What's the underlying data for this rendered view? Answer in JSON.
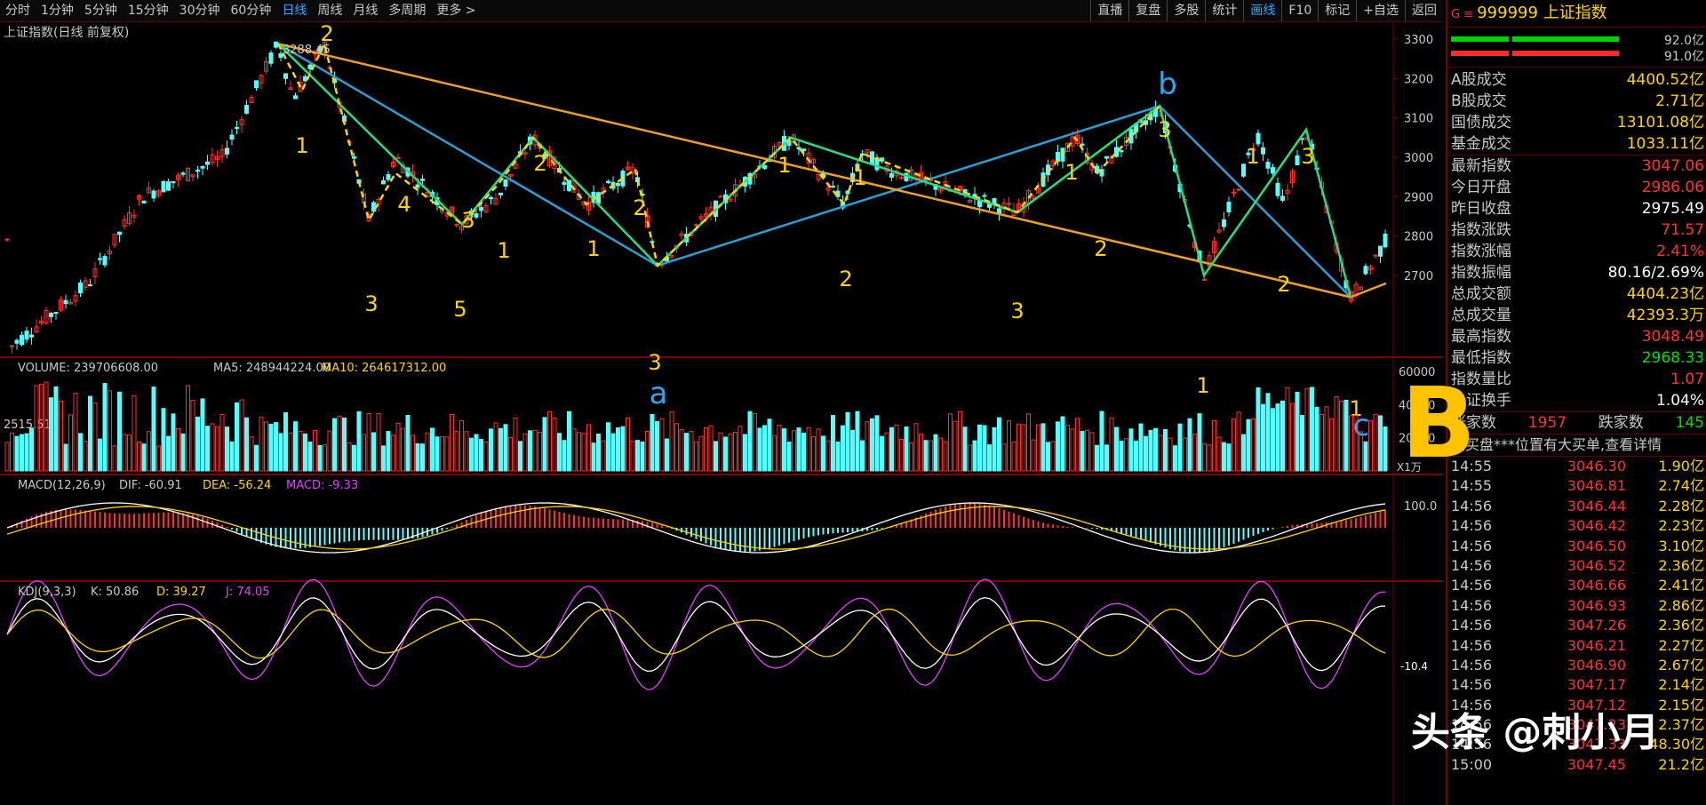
{
  "toolbar": {
    "left": [
      "分时",
      "1分钟",
      "5分钟",
      "15分钟",
      "30分钟",
      "60分钟",
      "日线",
      "周线",
      "月线",
      "多周期",
      "更多 >"
    ],
    "active_index": 6,
    "right": [
      "直播",
      "复盘",
      "多股",
      "统计",
      "画线",
      "F10",
      "标记",
      "+自选",
      "返回"
    ],
    "right_active_index": 4
  },
  "chart": {
    "title": "上证指数(日线 前复权)",
    "high_label": "3288.45",
    "low_label": "2515.51",
    "y_ticks": [
      "3300",
      "3200",
      "3100",
      "3000",
      "2900",
      "2800",
      "2700"
    ],
    "wave_labels_yellow": [
      "2",
      "1",
      "3",
      "4",
      "5",
      "3",
      "1",
      "2",
      "1",
      "2",
      "3",
      "1",
      "2",
      "1",
      "3",
      "1",
      "2",
      "3",
      "1",
      "1",
      "2",
      "3",
      "1"
    ],
    "wave_labels_blue": [
      "a",
      "b",
      "c"
    ]
  },
  "volume": {
    "label": "VOLUME: 239706608.00",
    "ma5": "MA5: 248944224.00",
    "ma10": "MA10: 264617312.00",
    "y_ticks": [
      "60000",
      "40000",
      "20000"
    ],
    "unit": "X1万"
  },
  "macd": {
    "label": "MACD(12,26,9)",
    "dif": "DIF: -60.91",
    "dea": "DEA: -56.24",
    "macd": "MACD: -9.33",
    "y_tick": "100.0"
  },
  "kdj": {
    "label": "KDJ(9,3,3)",
    "k": "K: 50.86",
    "d": "D: 39.27",
    "j": "J: 74.05",
    "axis_value": "-10.4"
  },
  "side": {
    "header_code": "999999",
    "header_name": "上证指数",
    "bar_values": [
      "92.0亿",
      "91.0亿"
    ],
    "turnover": [
      {
        "label": "A股成交",
        "value": "4400.52亿",
        "color": "#ffd400"
      },
      {
        "label": "B股成交",
        "value": "2.71亿",
        "color": "#ffd400"
      },
      {
        "label": "国债成交",
        "value": "13101.08亿",
        "color": "#ffd400"
      },
      {
        "label": "基金成交",
        "value": "1033.11亿",
        "color": "#ffd400"
      }
    ],
    "stats": [
      {
        "label": "最新指数",
        "value": "3047.06",
        "color": "#ff3333"
      },
      {
        "label": "今日开盘",
        "value": "2986.06",
        "color": "#ff3333"
      },
      {
        "label": "昨日收盘",
        "value": "2975.49",
        "color": "#ffffff"
      },
      {
        "label": "指数涨跌",
        "value": "71.57",
        "color": "#ff3333"
      },
      {
        "label": "指数涨幅",
        "value": "2.41%",
        "color": "#ff3333"
      },
      {
        "label": "指数振幅",
        "value": "80.16/2.69%",
        "color": "#ffffff"
      },
      {
        "label": "总成交额",
        "value": "4404.23亿",
        "color": "#ffd400"
      },
      {
        "label": "总成交量",
        "value": "42393.3万",
        "color": "#ffd400"
      },
      {
        "label": "最高指数",
        "value": "3048.49",
        "color": "#ff3333"
      },
      {
        "label": "最低指数",
        "value": "2968.33",
        "color": "#00e000"
      },
      {
        "label": "指数量比",
        "value": "1.07",
        "color": "#ff3333"
      },
      {
        "label": "上证换手",
        "value": "1.04%",
        "color": "#ffffff"
      }
    ],
    "up_label": "涨家数",
    "up_value": "1957",
    "down_label": "跌家数",
    "down_value": "145",
    "notice": "在买盘***位置有大买单,查看详情",
    "ticks": [
      {
        "t": "14:55",
        "p": "3046.30",
        "v": "1.90亿"
      },
      {
        "t": "14:55",
        "p": "3046.81",
        "v": "2.74亿"
      },
      {
        "t": "14:56",
        "p": "3046.44",
        "v": "2.28亿"
      },
      {
        "t": "14:56",
        "p": "3046.42",
        "v": "2.23亿"
      },
      {
        "t": "14:56",
        "p": "3046.50",
        "v": "3.10亿"
      },
      {
        "t": "14:56",
        "p": "3046.52",
        "v": "2.36亿"
      },
      {
        "t": "14:56",
        "p": "3046.66",
        "v": "2.41亿"
      },
      {
        "t": "14:56",
        "p": "3046.93",
        "v": "2.86亿"
      },
      {
        "t": "14:56",
        "p": "3047.26",
        "v": "2.36亿"
      },
      {
        "t": "14:56",
        "p": "3046.21",
        "v": "2.27亿"
      },
      {
        "t": "14:56",
        "p": "3046.90",
        "v": "2.67亿"
      },
      {
        "t": "14:56",
        "p": "3047.17",
        "v": "2.14亿"
      },
      {
        "t": "14:56",
        "p": "3047.12",
        "v": "2.15亿"
      },
      {
        "t": "14:56",
        "p": "3047.23",
        "v": "2.37亿"
      },
      {
        "t": "14:56",
        "p": "3047.33",
        "v": "48.30亿"
      },
      {
        "t": "15:00",
        "p": "3047.45",
        "v": "21.2亿"
      }
    ]
  },
  "overlay": {
    "big_letter": "B",
    "watermark": "头条 @刺小月"
  }
}
